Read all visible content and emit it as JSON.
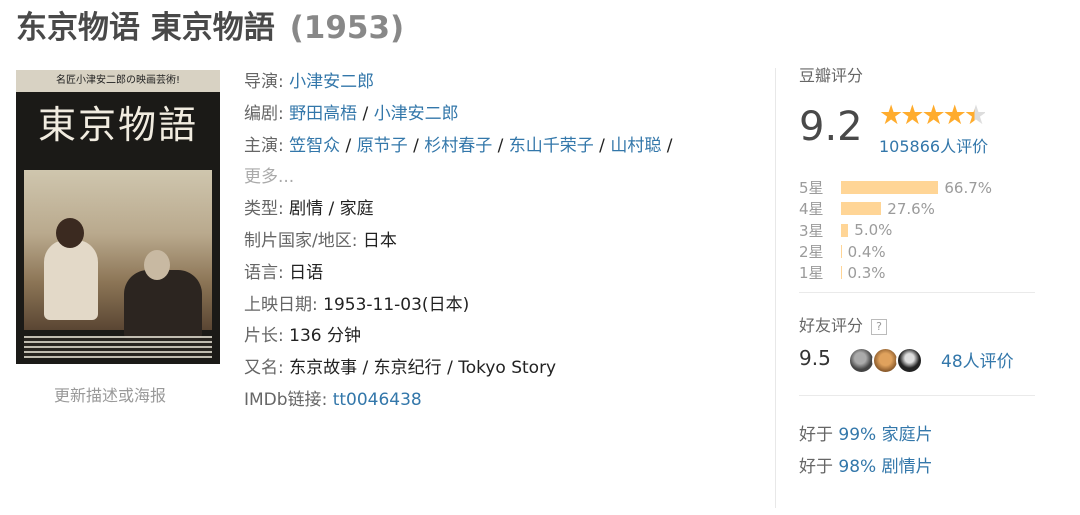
{
  "title": {
    "name": "东京物语 東京物語",
    "year": "(1953)"
  },
  "poster": {
    "banner": "名匠小津安二郎の映画芸術!",
    "title_text": "東京物語",
    "update_link": "更新描述或海报"
  },
  "info": {
    "director": {
      "label": "导演",
      "values": [
        "小津安二郎"
      ]
    },
    "writer": {
      "label": "编剧",
      "values": [
        "野田高梧",
        "小津安二郎"
      ]
    },
    "cast": {
      "label": "主演",
      "values": [
        "笠智众",
        "原节子",
        "杉村春子",
        "东山千荣子",
        "山村聪"
      ],
      "more": "更多..."
    },
    "genre": {
      "label": "类型",
      "value": "剧情 / 家庭"
    },
    "country": {
      "label": "制片国家/地区",
      "value": "日本"
    },
    "language": {
      "label": "语言",
      "value": "日语"
    },
    "release": {
      "label": "上映日期",
      "value": "1953-11-03(日本)"
    },
    "runtime": {
      "label": "片长",
      "value": "136 分钟"
    },
    "aka": {
      "label": "又名",
      "value": "东京故事 / 东京纪行 / Tokyo Story"
    },
    "imdb": {
      "label": "IMDb链接",
      "value": "tt0046438"
    }
  },
  "rating": {
    "label": "豆瓣评分",
    "score": "9.2",
    "stars": 4.5,
    "count": "105866人评价",
    "distribution": [
      {
        "star": "5星",
        "percent": "66.7%",
        "value": 66.7
      },
      {
        "star": "4星",
        "percent": "27.6%",
        "value": 27.6
      },
      {
        "star": "3星",
        "percent": "5.0%",
        "value": 5.0
      },
      {
        "star": "2星",
        "percent": "0.4%",
        "value": 0.4
      },
      {
        "star": "1星",
        "percent": "0.3%",
        "value": 0.3
      }
    ],
    "colors": {
      "bar": "#ffd596",
      "star": "#ffac2d",
      "link": "#3377aa"
    }
  },
  "friends": {
    "label": "好友评分",
    "help": "?",
    "score": "9.5",
    "count": "48人评价"
  },
  "better_than": [
    {
      "prefix": "好于",
      "percent": "99%",
      "genre": "家庭片"
    },
    {
      "prefix": "好于",
      "percent": "98%",
      "genre": "剧情片"
    }
  ]
}
